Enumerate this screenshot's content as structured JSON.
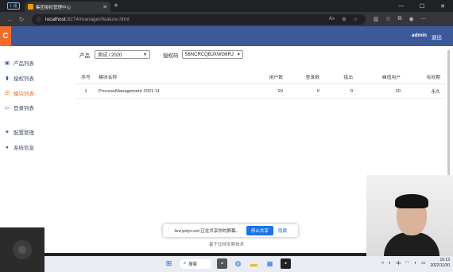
{
  "browser": {
    "tab_count": "1 组",
    "tab_title": "集团授权管理中心",
    "url_host": "localhost",
    "url_path": ":8274/manager/feature.html"
  },
  "header": {
    "logo": "C",
    "user": "admin",
    "logout": "退出"
  },
  "sidebar": {
    "items": [
      {
        "label": "产品列表",
        "icon": "briefcase-icon"
      },
      {
        "label": "授权列表",
        "icon": "bookmark-icon"
      },
      {
        "label": "模块列表",
        "icon": "list-icon"
      },
      {
        "label": "登录列表",
        "icon": "monitor-icon"
      },
      {
        "label": "配置管理",
        "icon": "gear-icon"
      },
      {
        "label": "系统信息",
        "icon": "info-icon"
      }
    ]
  },
  "filters": {
    "product_label": "产品",
    "product_value": "测试 / 2020",
    "auth_label": "授权码",
    "auth_value": "S6NCRCQBJXWG6RJ"
  },
  "table": {
    "headers": [
      "序号",
      "模块名称",
      "用户数",
      "登录数",
      "借出",
      "峰值用户",
      "有效期"
    ],
    "rows": [
      [
        "1",
        "ProcessManagement 2021.11",
        "20",
        "0",
        "0",
        "20",
        "永久"
      ]
    ]
  },
  "footer": "基于比特安索技术",
  "share_bar": {
    "message": "live.polyv.net 正在共享你的屏幕。",
    "stop": "停止共享",
    "hide": "隐藏"
  },
  "taskbar": {
    "search": "搜索",
    "ime": "中",
    "time": "16:13",
    "date": "2022/11/30"
  }
}
